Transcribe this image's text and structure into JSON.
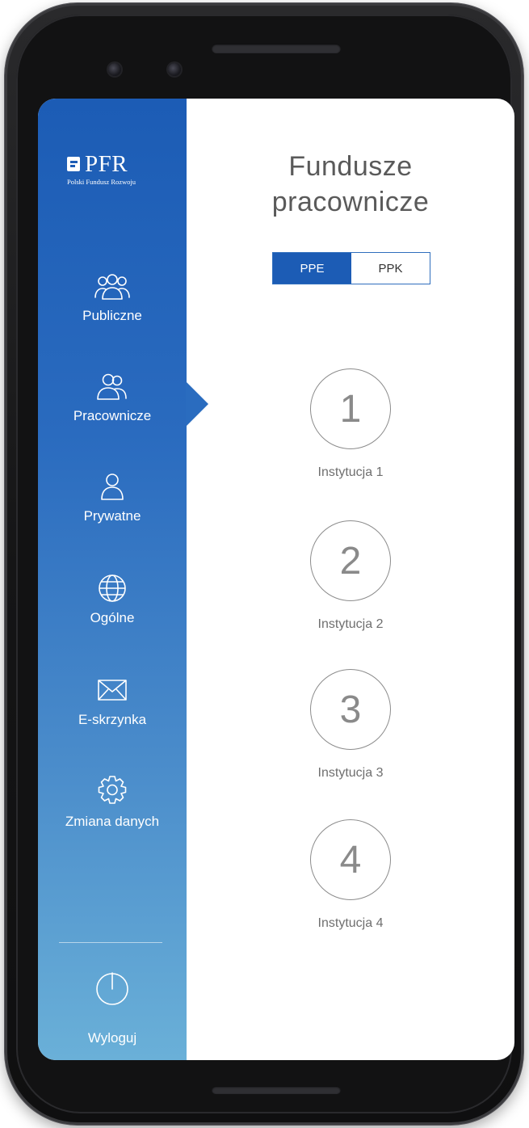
{
  "brand": {
    "logo_text": "PFR",
    "logo_subtitle": "Polski Fundusz Rozwoju",
    "primary_color": "#1c5cb5",
    "gradient_bottom_color": "#6ab0d8"
  },
  "sidebar": {
    "items": [
      {
        "label": "Publiczne",
        "icon": "group-three-people-icon",
        "active": false
      },
      {
        "label": "Pracownicze",
        "icon": "group-two-people-icon",
        "active": true
      },
      {
        "label": "Prywatne",
        "icon": "single-person-icon",
        "active": false
      },
      {
        "label": "Ogólne",
        "icon": "globe-icon",
        "active": false
      },
      {
        "label": "E-skrzynka",
        "icon": "envelope-icon",
        "active": false
      },
      {
        "label": "Zmiana danych",
        "icon": "gear-icon",
        "active": false
      }
    ],
    "logout": {
      "label": "Wyloguj",
      "icon": "power-icon"
    }
  },
  "main": {
    "title_line1": "Fundusze",
    "title_line2": "pracownicze",
    "tabs": [
      {
        "label": "PPE",
        "active": true
      },
      {
        "label": "PPK",
        "active": false
      }
    ],
    "institutions": [
      {
        "number": "1",
        "label": "Instytucja 1"
      },
      {
        "number": "2",
        "label": "Instytucja 2"
      },
      {
        "number": "3",
        "label": "Instytucja 3"
      },
      {
        "number": "4",
        "label": "Instytucja 4"
      }
    ]
  }
}
